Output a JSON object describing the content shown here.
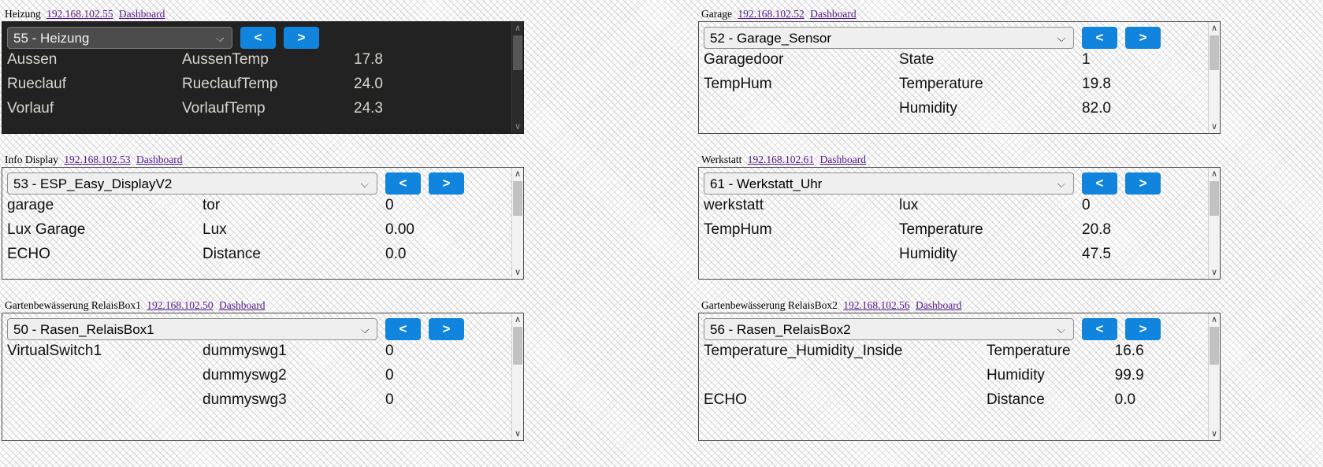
{
  "page": {
    "background_pattern": "chevron-diagonal-lines"
  },
  "colors": {
    "nav_button": "#1184dd",
    "link": "#551a8b",
    "dark_panel_bg": "#222222",
    "dark_panel_text": "#d9d6cf",
    "panel_border": "#4a4a4a"
  },
  "common": {
    "prev_label": "<",
    "next_label": ">",
    "dashboard_label": "Dashboard",
    "scroll_up_glyph": "∧",
    "scroll_down_glyph": "∨"
  },
  "panels": [
    {
      "caption": "Heizung",
      "ip": "192.168.102.55",
      "dashboard": "Dashboard",
      "selected_device": "55 - Heizung",
      "theme": "dark",
      "rows": [
        {
          "task": "Aussen",
          "name": "AussenTemp",
          "value": "17.8"
        },
        {
          "task": "Rueclauf",
          "name": "RueclaufTemp",
          "value": "24.0"
        },
        {
          "task": "Vorlauf",
          "name": "VorlaufTemp",
          "value": "24.3"
        }
      ]
    },
    {
      "caption": "Garage",
      "ip": "192.168.102.52",
      "dashboard": "Dashboard",
      "selected_device": "52 - Garage_Sensor",
      "theme": "light",
      "rows": [
        {
          "task": "Garagedoor",
          "name": "State",
          "value": "1"
        },
        {
          "task": "TempHum",
          "name": "Temperature",
          "value": "19.8"
        },
        {
          "task": "",
          "name": "Humidity",
          "value": "82.0"
        }
      ]
    },
    {
      "caption": "Info Display",
      "ip": "192.168.102.53",
      "dashboard": "Dashboard",
      "selected_device": "53 - ESP_Easy_DisplayV2",
      "theme": "light",
      "rows": [
        {
          "task": "garage",
          "name": "tor",
          "value": "0"
        },
        {
          "task": "Lux Garage",
          "name": "Lux",
          "value": "0.00"
        },
        {
          "task": "ECHO",
          "name": "Distance",
          "value": "0.0"
        }
      ]
    },
    {
      "caption": "Werkstatt",
      "ip": "192.168.102.61",
      "dashboard": "Dashboard",
      "selected_device": "61 - Werkstatt_Uhr",
      "theme": "light",
      "rows": [
        {
          "task": "werkstatt",
          "name": "lux",
          "value": "0"
        },
        {
          "task": "TempHum",
          "name": "Temperature",
          "value": "20.8"
        },
        {
          "task": "",
          "name": "Humidity",
          "value": "47.5"
        }
      ]
    },
    {
      "caption": "Gartenbewässerung RelaisBox1",
      "ip": "192.168.102.50",
      "dashboard": "Dashboard",
      "selected_device": "50 - Rasen_RelaisBox1",
      "theme": "light",
      "rows": [
        {
          "task": "VirtualSwitch1",
          "name": "dummyswg1",
          "value": "0"
        },
        {
          "task": "",
          "name": "dummyswg2",
          "value": "0"
        },
        {
          "task": "",
          "name": "dummyswg3",
          "value": "0"
        }
      ]
    },
    {
      "caption": "Gartenbewässerung RelaisBox2",
      "ip": "192.168.102.56",
      "dashboard": "Dashboard",
      "selected_device": "56 - Rasen_RelaisBox2",
      "theme": "light",
      "rows": [
        {
          "task": "Temperature_Humidity_Inside",
          "name": "Temperature",
          "value": "16.6"
        },
        {
          "task": "",
          "name": "Humidity",
          "value": "99.9"
        },
        {
          "task": "ECHO",
          "name": "Distance",
          "value": "0.0"
        }
      ]
    }
  ]
}
